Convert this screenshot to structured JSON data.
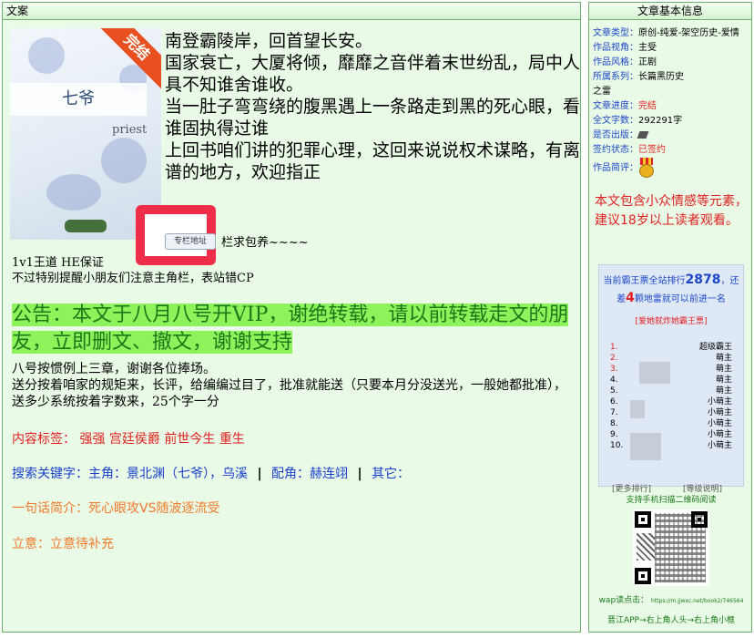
{
  "left_panel": {
    "header": "文案"
  },
  "cover": {
    "book_title": "七爷",
    "author": "priest",
    "badge": "完结"
  },
  "description": [
    "南登霸陵岸，回首望长安。",
    "国家衰亡，大厦将倾，靡靡之音伴着末世纷乱，局中人具不知谁舍谁收。",
    "当一肚子弯弯绕的腹黑遇上一条路走到黑的死心眼，看谁固执得过谁",
    "上回书咱们讲的犯罪心理，这回来说说权术谋略，有离谱的地方，欢迎指正"
  ],
  "column_button": "专栏地址",
  "stray_text": "栏求包养~~~~",
  "line_1v1": "1v1王道 HE保证",
  "note_line": "不过特别提醒小朋友们注意主角栏，表站错CP",
  "announcement": "公告：本文于八月八号开VIP，谢绝转载，请以前转载走文的朋友，立即删文、撤文，谢谢支持",
  "paragraphs": [
    "八号按惯例上三章，谢谢各位捧场。",
    "送分按着咱家的规矩来，长评，给编编过目了，批准就能送（只要本月分没送光，一般她都批准），送多少系统按着字数来，25个字一分"
  ],
  "tags": {
    "label": "内容标签：",
    "items": [
      "强强",
      "宫廷侯爵",
      "前世今生",
      "重生"
    ]
  },
  "keywords": {
    "label": "搜索关键字：",
    "main_label": "主角：",
    "main": "景北渊（七爷），乌溪",
    "support_label": "配角：",
    "support": "赫连翊",
    "other_label": "其它："
  },
  "one_line": {
    "label": "一句话简介：",
    "value": "死心眼攻VS随波逐流受"
  },
  "intent": {
    "label": "立意：",
    "value": "立意待补充"
  },
  "right_panel": {
    "header": "文章基本信息",
    "info": [
      {
        "key": "文章类型：",
        "value": "原创-纯爱-架空历史-爱情"
      },
      {
        "key": "作品视角：",
        "value": "主受"
      },
      {
        "key": "作品风格：",
        "value": "正剧"
      },
      {
        "key": "所属系列：",
        "value": "长篇黑历史"
      }
    ],
    "series_tail": "之雷",
    "progress_key": "文章进度：",
    "progress_value": "完结",
    "words_key": "全文字数：",
    "words_value": "292291字",
    "published_key": "是否出版：",
    "sign_key": "签约状态：",
    "sign_value": "已签约",
    "review_key": "作品简评：",
    "warning": "本文包含小众情感等元素，建议18岁以上读者观看。"
  },
  "ranking": {
    "line1_pre": "当前霸王票全站排行",
    "rank": "2878",
    "line1_post": "，还",
    "line2_pre": "差",
    "gap": "4",
    "line2_post": "颗地雷就可以前进一名",
    "link": "[爱她就炸她霸王票]",
    "entries": [
      {
        "n": "1.",
        "title": "超级霸王"
      },
      {
        "n": "2.",
        "title": "萌主"
      },
      {
        "n": "3.",
        "title": "萌主"
      },
      {
        "n": "4.",
        "title": "萌主"
      },
      {
        "n": "5.",
        "title": "萌主"
      },
      {
        "n": "6.",
        "title": "小萌主"
      },
      {
        "n": "7.",
        "title": "小萌主"
      },
      {
        "n": "8.",
        "title": "小萌主"
      },
      {
        "n": "9.",
        "title": "小萌主"
      },
      {
        "n": "10.",
        "title": "小萌主"
      }
    ],
    "more": "[更多排行]",
    "levels": "[等级说明]"
  },
  "qr": {
    "title": "支持手机扫描二维码阅读",
    "wap_label": "wap读点击：",
    "wap_url": "https://m.jjwxc.net/book2/746564",
    "app_line": "晋江APP→右上角人头→右上角小框"
  }
}
